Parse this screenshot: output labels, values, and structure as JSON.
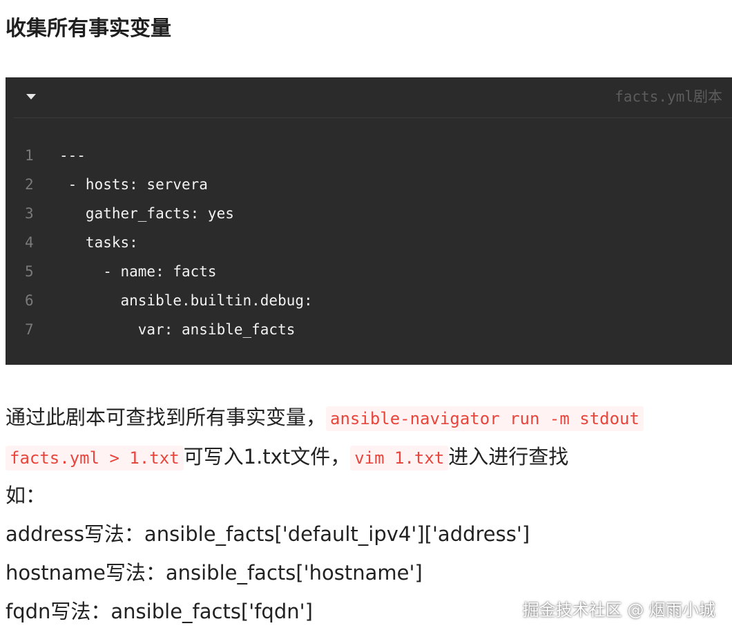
{
  "heading": "收集所有事实变量",
  "code_block": {
    "filename": "facts.yml剧本",
    "lines": [
      {
        "no": "1",
        "text": "---"
      },
      {
        "no": "2",
        "text": " - hosts: servera"
      },
      {
        "no": "3",
        "text": "   gather_facts: yes"
      },
      {
        "no": "4",
        "text": "   tasks:"
      },
      {
        "no": "5",
        "text": "     - name: facts"
      },
      {
        "no": "6",
        "text": "       ansible.builtin.debug:"
      },
      {
        "no": "7",
        "text": "         var: ansible_facts"
      }
    ]
  },
  "paragraph": {
    "line1_text": "通过此剧本可查找到所有事实变量，",
    "line1_code": "ansible-navigator run -m stdout",
    "line2_code": "facts.yml > 1.txt",
    "line2_text_a": "可写入1.txt文件，",
    "line2_code_b": "vim 1.txt",
    "line2_text_b": "进入进行查找",
    "line3": "如：",
    "line4": "address写法：ansible_facts['default_ipv4']['address']",
    "line5": "hostname写法：ansible_facts['hostname']",
    "line6": "fqdn写法：ansible_facts['fqdn']"
  },
  "watermark": "掘金技术社区 @ 烟雨小城",
  "colors": {
    "code_bg": "#2b2b2b",
    "inline_code_fg": "#e8453c",
    "inline_code_bg": "#fff4f3"
  }
}
